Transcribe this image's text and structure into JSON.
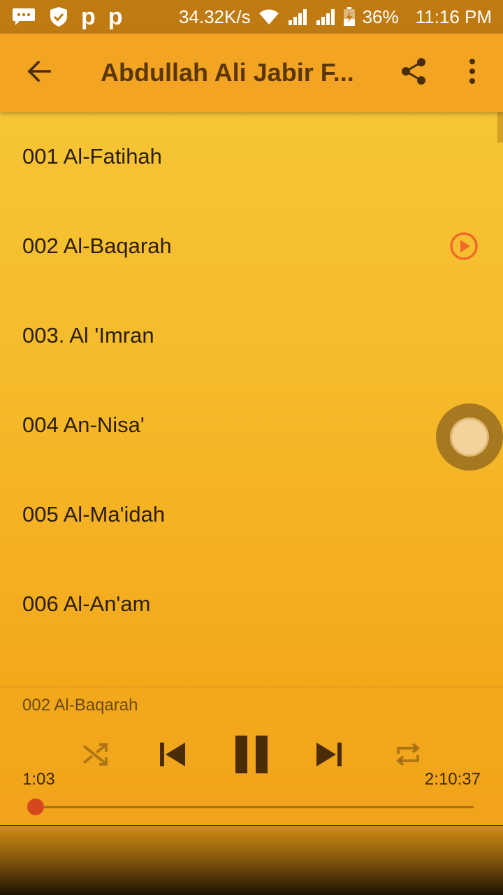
{
  "status_bar": {
    "net_speed": "34.32K/s",
    "battery": "36%",
    "time": "11:16 PM",
    "icons": [
      "chat-icon",
      "shield-icon",
      "p-icon",
      "p-icon",
      "wifi-icon",
      "signal-icon",
      "signal-icon",
      "battery-icon"
    ],
    "p_glyph": "p"
  },
  "app_bar": {
    "title": "Abdullah Ali Jabir F...",
    "icons": [
      "back-arrow-icon",
      "share-icon",
      "more-vert-icon"
    ]
  },
  "tracks": [
    {
      "label": "001 Al-Fatihah",
      "playing": false
    },
    {
      "label": "002 Al-Baqarah",
      "playing": true
    },
    {
      "label": "003. Al 'Imran",
      "playing": false
    },
    {
      "label": "004 An-Nisa'",
      "playing": false
    },
    {
      "label": "005 Al-Ma'idah",
      "playing": false
    },
    {
      "label": "006 Al-An'am",
      "playing": false
    }
  ],
  "player": {
    "now_playing": "002 Al-Baqarah",
    "elapsed": "1:03",
    "duration": "2:10:37",
    "progress_fraction": 0.008,
    "icons": [
      "shuffle-icon",
      "skip-previous-icon",
      "pause-icon",
      "skip-next-icon",
      "repeat-icon"
    ]
  },
  "colors": {
    "accent": "#f2a422",
    "status_bar": "#c07a12",
    "seek": "#d5481e",
    "play_indicator": "#f06a2a",
    "title": "#5b3708"
  }
}
